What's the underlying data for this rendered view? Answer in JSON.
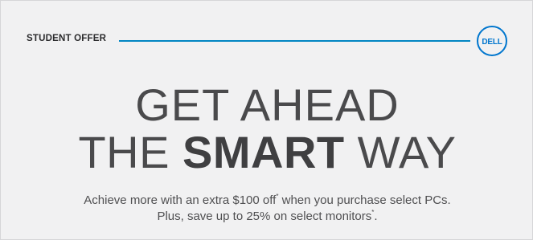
{
  "banner": {
    "eyebrow": "STUDENT OFFER",
    "logo_text": "DELL",
    "headline": {
      "line1": "GET AHEAD",
      "line2_prefix": "THE ",
      "line2_emphasis": "SMART",
      "line2_suffix": " WAY"
    },
    "body": {
      "line1_before": "Achieve more with an extra $100 off",
      "line1_mark": "*",
      "line1_after": " when you purchase select PCs.",
      "line2_before": "Plus, save up to 25% on select monitors",
      "line2_mark": "*",
      "line2_after": "."
    },
    "colors": {
      "accent": "#0085c3",
      "logo": "#0076ce",
      "background": "#f1f1f2",
      "text": "#4a4a4c"
    }
  }
}
